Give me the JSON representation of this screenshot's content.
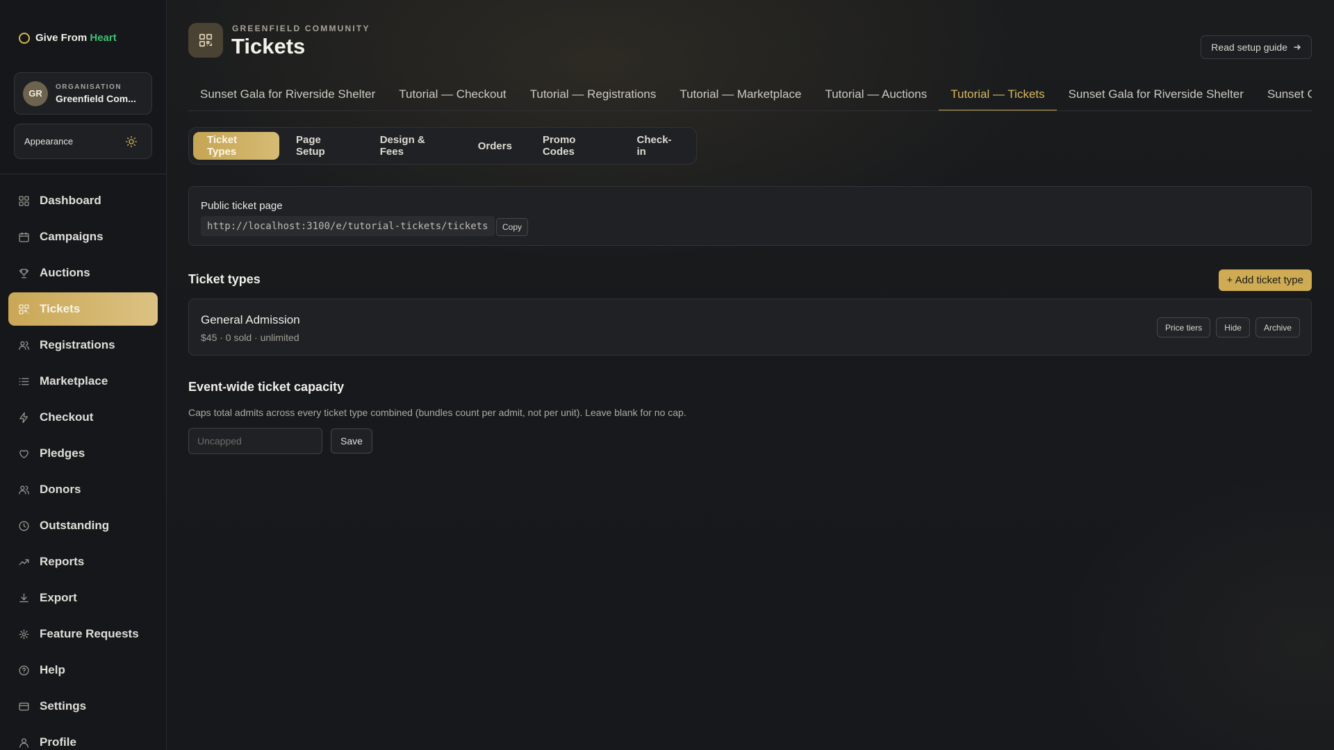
{
  "brand": {
    "prefix": "Give From ",
    "accent": "Heart"
  },
  "org": {
    "eyebrow": "ORGANISATION",
    "initials": "GR",
    "name": "Greenfield Com..."
  },
  "appearance": {
    "label": "Appearance"
  },
  "nav": [
    {
      "label": "Dashboard",
      "icon": "grid-icon",
      "active": false
    },
    {
      "label": "Campaigns",
      "icon": "calendar-icon",
      "active": false
    },
    {
      "label": "Auctions",
      "icon": "trophy-icon",
      "active": false
    },
    {
      "label": "Tickets",
      "icon": "qr-grid-icon",
      "active": true
    },
    {
      "label": "Registrations",
      "icon": "users-icon",
      "active": false
    },
    {
      "label": "Marketplace",
      "icon": "list-icon",
      "active": false
    },
    {
      "label": "Checkout",
      "icon": "bolt-icon",
      "active": false
    },
    {
      "label": "Pledges",
      "icon": "heart-icon",
      "active": false
    },
    {
      "label": "Donors",
      "icon": "users-icon",
      "active": false
    },
    {
      "label": "Outstanding",
      "icon": "clock-icon",
      "active": false
    },
    {
      "label": "Reports",
      "icon": "trend-icon",
      "active": false
    },
    {
      "label": "Export",
      "icon": "download-icon",
      "active": false
    },
    {
      "label": "Feature Requests",
      "icon": "sparkle-icon",
      "active": false
    },
    {
      "label": "Help",
      "icon": "help-icon",
      "active": false
    },
    {
      "label": "Settings",
      "icon": "card-icon",
      "active": false
    },
    {
      "label": "Profile",
      "icon": "user-icon",
      "active": false
    }
  ],
  "header": {
    "eyebrow": "GREENFIELD COMMUNITY",
    "title": "Tickets",
    "guide_label": "Read setup guide"
  },
  "event_tabs": [
    {
      "label": "Sunset Gala for Riverside Shelter",
      "active": false
    },
    {
      "label": "Tutorial — Checkout",
      "active": false
    },
    {
      "label": "Tutorial — Registrations",
      "active": false
    },
    {
      "label": "Tutorial — Marketplace",
      "active": false
    },
    {
      "label": "Tutorial — Auctions",
      "active": false
    },
    {
      "label": "Tutorial — Tickets",
      "active": true
    },
    {
      "label": "Sunset Gala for Riverside Shelter",
      "active": false
    },
    {
      "label": "Sunset Gala for Riverside Shelter",
      "active": false
    }
  ],
  "sub_tabs": [
    {
      "label": "Ticket Types",
      "active": true
    },
    {
      "label": "Page Setup",
      "active": false
    },
    {
      "label": "Design & Fees",
      "active": false
    },
    {
      "label": "Orders",
      "active": false
    },
    {
      "label": "Promo Codes",
      "active": false
    },
    {
      "label": "Check-in",
      "active": false
    }
  ],
  "public_page": {
    "label": "Public ticket page",
    "url": "http://localhost:3100/e/tutorial-tickets/tickets",
    "copy_label": "Copy"
  },
  "ticket_types": {
    "title": "Ticket types",
    "add_label": "+ Add ticket type",
    "items": [
      {
        "name": "General Admission",
        "meta": "$45 · 0 sold · unlimited",
        "actions": [
          "Price tiers",
          "Hide",
          "Archive"
        ]
      }
    ]
  },
  "capacity": {
    "title": "Event-wide ticket capacity",
    "description": "Caps total admits across every ticket type combined (bundles count per admit, not per unit). Leave blank for no cap.",
    "placeholder": "Uncapped",
    "value": "",
    "save_label": "Save"
  },
  "colors": {
    "accent": "#c9a755",
    "brand_green": "#3fbf74",
    "background": "#16181c"
  }
}
